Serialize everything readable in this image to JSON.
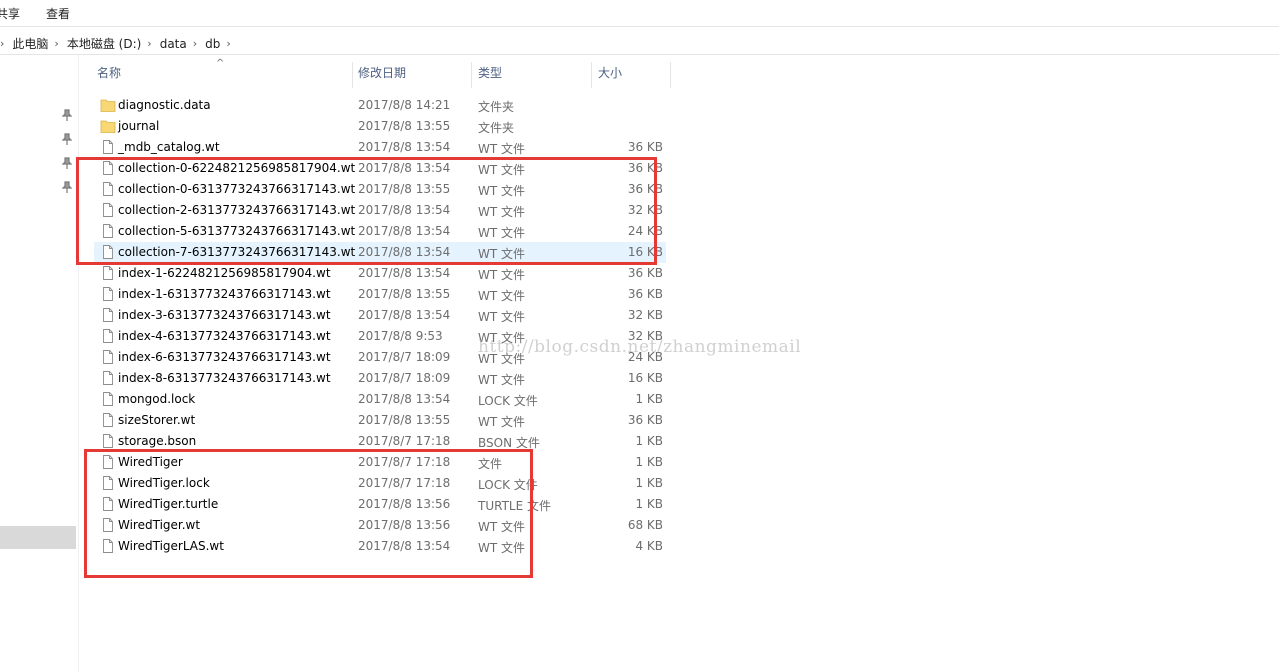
{
  "ribbon": {
    "tabs": [
      "共享",
      "查看"
    ]
  },
  "breadcrumb": [
    "此电脑",
    "本地磁盘 (D:)",
    "data",
    "db"
  ],
  "columns": {
    "name": "名称",
    "date": "修改日期",
    "type": "类型",
    "size": "大小"
  },
  "files": [
    {
      "name": "diagnostic.data",
      "date": "2017/8/8 14:21",
      "type": "文件夹",
      "size": "",
      "icon": "folder-icon"
    },
    {
      "name": "journal",
      "date": "2017/8/8 13:55",
      "type": "文件夹",
      "size": "",
      "icon": "folder-icon"
    },
    {
      "name": "_mdb_catalog.wt",
      "date": "2017/8/8 13:54",
      "type": "WT 文件",
      "size": "36 KB",
      "icon": "file-icon"
    },
    {
      "name": "collection-0-6224821256985817904.wt",
      "date": "2017/8/8 13:54",
      "type": "WT 文件",
      "size": "36 KB",
      "icon": "file-icon"
    },
    {
      "name": "collection-0-6313773243766317143.wt",
      "date": "2017/8/8 13:55",
      "type": "WT 文件",
      "size": "36 KB",
      "icon": "file-icon"
    },
    {
      "name": "collection-2-6313773243766317143.wt",
      "date": "2017/8/8 13:54",
      "type": "WT 文件",
      "size": "32 KB",
      "icon": "file-icon"
    },
    {
      "name": "collection-5-6313773243766317143.wt",
      "date": "2017/8/8 13:54",
      "type": "WT 文件",
      "size": "24 KB",
      "icon": "file-icon"
    },
    {
      "name": "collection-7-6313773243766317143.wt",
      "date": "2017/8/8 13:54",
      "type": "WT 文件",
      "size": "16 KB",
      "icon": "file-icon",
      "selected": true
    },
    {
      "name": "index-1-6224821256985817904.wt",
      "date": "2017/8/8 13:54",
      "type": "WT 文件",
      "size": "36 KB",
      "icon": "file-icon"
    },
    {
      "name": "index-1-6313773243766317143.wt",
      "date": "2017/8/8 13:55",
      "type": "WT 文件",
      "size": "36 KB",
      "icon": "file-icon"
    },
    {
      "name": "index-3-6313773243766317143.wt",
      "date": "2017/8/8 13:54",
      "type": "WT 文件",
      "size": "32 KB",
      "icon": "file-icon"
    },
    {
      "name": "index-4-6313773243766317143.wt",
      "date": "2017/8/8 9:53",
      "type": "WT 文件",
      "size": "32 KB",
      "icon": "file-icon"
    },
    {
      "name": "index-6-6313773243766317143.wt",
      "date": "2017/8/7 18:09",
      "type": "WT 文件",
      "size": "24 KB",
      "icon": "file-icon"
    },
    {
      "name": "index-8-6313773243766317143.wt",
      "date": "2017/8/7 18:09",
      "type": "WT 文件",
      "size": "16 KB",
      "icon": "file-icon"
    },
    {
      "name": "mongod.lock",
      "date": "2017/8/8 13:54",
      "type": "LOCK 文件",
      "size": "1 KB",
      "icon": "file-icon"
    },
    {
      "name": "sizeStorer.wt",
      "date": "2017/8/8 13:55",
      "type": "WT 文件",
      "size": "36 KB",
      "icon": "file-icon"
    },
    {
      "name": "storage.bson",
      "date": "2017/8/7 17:18",
      "type": "BSON 文件",
      "size": "1 KB",
      "icon": "file-icon"
    },
    {
      "name": "WiredTiger",
      "date": "2017/8/7 17:18",
      "type": "文件",
      "size": "1 KB",
      "icon": "file-icon"
    },
    {
      "name": "WiredTiger.lock",
      "date": "2017/8/7 17:18",
      "type": "LOCK 文件",
      "size": "1 KB",
      "icon": "file-icon"
    },
    {
      "name": "WiredTiger.turtle",
      "date": "2017/8/8 13:56",
      "type": "TURTLE 文件",
      "size": "1 KB",
      "icon": "file-icon"
    },
    {
      "name": "WiredTiger.wt",
      "date": "2017/8/8 13:56",
      "type": "WT 文件",
      "size": "68 KB",
      "icon": "file-icon"
    },
    {
      "name": "WiredTigerLAS.wt",
      "date": "2017/8/8 13:54",
      "type": "WT 文件",
      "size": "4 KB",
      "icon": "file-icon"
    }
  ],
  "watermark": "http://blog.csdn.net/zhangminemail",
  "colors": {
    "highlight_box": "#e53935",
    "selected_row": "#e5f3ff",
    "folder": "#f8d775"
  }
}
